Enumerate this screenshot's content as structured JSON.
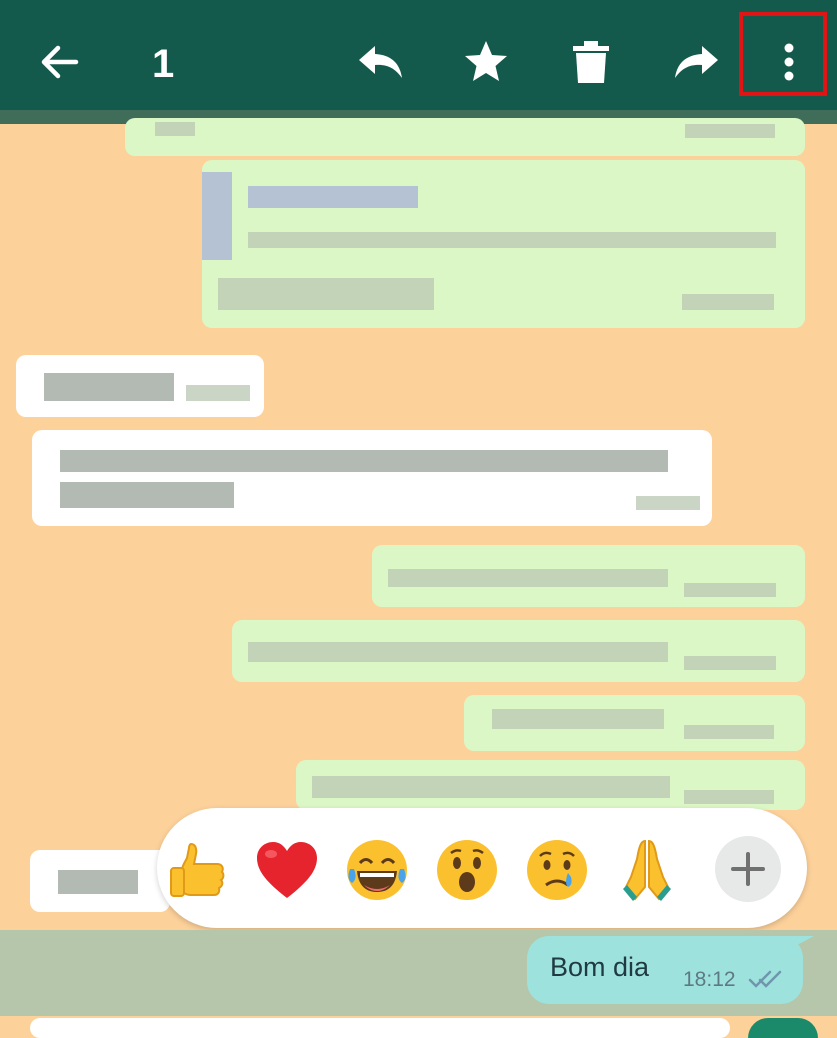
{
  "toolbar": {
    "selected_count": "1",
    "back_icon": "arrow-left-icon",
    "reply_icon": "reply-icon",
    "star_icon": "star-icon",
    "delete_icon": "trash-icon",
    "forward_icon": "forward-icon",
    "menu_icon": "more-vert-icon",
    "background_color": "#145a4c",
    "highlight_color": "#e01414"
  },
  "reaction_bar": {
    "emojis": [
      "👍",
      "❤️",
      "😂",
      "😮",
      "😢",
      "🙏"
    ],
    "more_icon": "plus-icon"
  },
  "selected_message": {
    "text": "Bom dia",
    "time": "18:12",
    "status_icon": "double-check-icon"
  },
  "colors": {
    "chat_background": "#fdd19a",
    "outgoing_bubble": "#dcf7c6",
    "incoming_bubble": "#ffffff",
    "selected_bubble": "#9ee2de",
    "selection_overlay": "#b5c6ab"
  }
}
